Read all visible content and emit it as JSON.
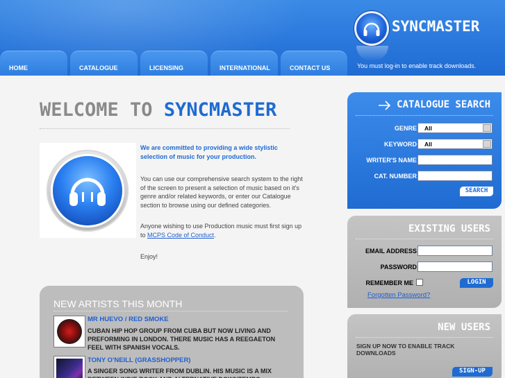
{
  "header": {
    "brand": "SYNCMASTER",
    "login_note": "You must log-in to enable track downloads.",
    "tabs": [
      {
        "label": "HOME"
      },
      {
        "label": "CATALOGUE"
      },
      {
        "label": "LICENSING"
      },
      {
        "label": "INTERNATIONAL"
      },
      {
        "label": "CONTACT US"
      }
    ]
  },
  "main": {
    "welcome_part1": "WELCOME TO ",
    "welcome_part2": "SYNCMASTER",
    "intro_bold": "We are committed to providing a wide stylistic selection of music for your production.",
    "intro_search": "You can use our comprehensive search system to the right of the screen to present a selection of music based on it's genre and/or related keywords, or enter our Catalogue section to browse using our defined categories.",
    "intro_signup_prefix": "Anyone wishing to use Production music must first sign up to ",
    "intro_link": "MCPS Code of Conduct",
    "intro_signup_suffix": ".",
    "enjoy": "Enjoy!"
  },
  "artists": {
    "title": "NEW ARTISTS THIS MONTH",
    "items": [
      {
        "name": "MR HUEVO / RED SMOKE",
        "desc": "Cuban Hip Hop group from Cuba but now living and preforming in London. There music has a reegaeton feel with Spanish vocals."
      },
      {
        "name": "TONY O'NEILL (GRASSHOPPER)",
        "desc": "A singer song writer from Dublin. His music is a mix between indie rock and alternative downtempo."
      }
    ]
  },
  "search": {
    "title": "CATALOGUE SEARCH",
    "genre_label": "GENRE",
    "genre_value": "All",
    "keyword_label": "KEYWORD",
    "keyword_value": "All",
    "writer_label": "WRITER'S NAME",
    "cat_label": "CAT. NUMBER",
    "button": "SEARCH"
  },
  "login": {
    "title": "EXISTING USERS",
    "email_label": "EMAIL ADDRESS",
    "password_label": "PASSWORD",
    "remember_label": "REMEMBER ME",
    "button": "LOGIN",
    "forgot": "Forgotten Password?"
  },
  "signup": {
    "title": "NEW USERS",
    "text": "SIGN UP NOW TO ENABLE TRACK DOWNLOADS",
    "button": "SIGN-UP"
  },
  "colors": {
    "brand_blue": "#1f6bd2",
    "panel_grey": "#b5b5b5",
    "button_blue": "#1f6bd2"
  }
}
